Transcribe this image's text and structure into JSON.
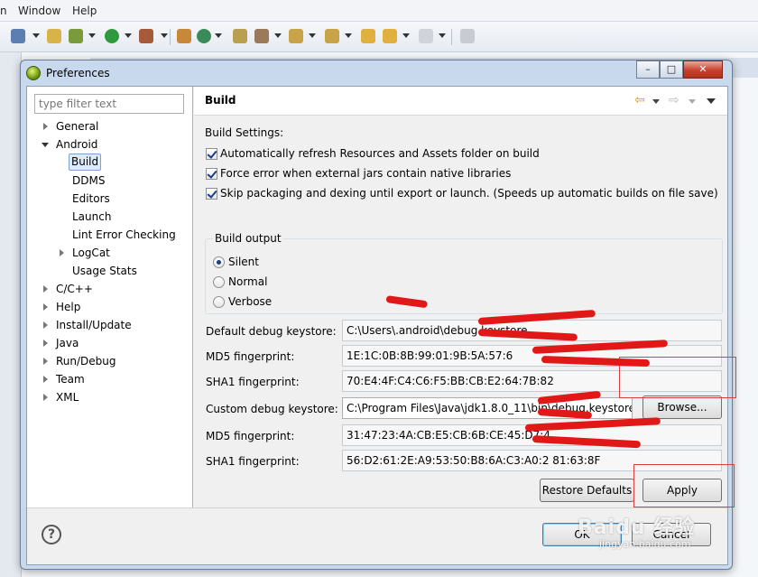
{
  "ide": {
    "menu": [
      "n",
      "Window",
      "Help"
    ]
  },
  "dialog": {
    "title": "Preferences",
    "filter_placeholder": "type filter text",
    "tree": [
      {
        "label": "General",
        "expanded": false
      },
      {
        "label": "Android",
        "expanded": true
      },
      {
        "label": "Build",
        "selected": true
      },
      {
        "label": "DDMS"
      },
      {
        "label": "Editors"
      },
      {
        "label": "Launch"
      },
      {
        "label": "Lint Error Checking"
      },
      {
        "label": "LogCat",
        "expanded": false
      },
      {
        "label": "Usage Stats"
      },
      {
        "label": "C/C++",
        "expanded": false
      },
      {
        "label": "Help",
        "expanded": false
      },
      {
        "label": "Install/Update",
        "expanded": false
      },
      {
        "label": "Java",
        "expanded": false
      },
      {
        "label": "Run/Debug",
        "expanded": false
      },
      {
        "label": "Team",
        "expanded": false
      },
      {
        "label": "XML",
        "expanded": false
      }
    ],
    "page_title": "Build",
    "build_settings_label": "Build Settings:",
    "checkboxes": [
      {
        "label": "Automatically refresh Resources and Assets folder on build",
        "checked": true
      },
      {
        "label": "Force error when external jars contain native libraries",
        "checked": true
      },
      {
        "label": "Skip packaging and dexing until export or launch. (Speeds up automatic builds on file save)",
        "checked": true
      }
    ],
    "build_output": {
      "legend": "Build output",
      "options": [
        {
          "label": "Silent",
          "selected": true
        },
        {
          "label": "Normal",
          "selected": false
        },
        {
          "label": "Verbose",
          "selected": false
        }
      ]
    },
    "fields": [
      {
        "label": "Default debug keystore:",
        "value": "C:\\Users\\.android\\debug.keystore"
      },
      {
        "label": "MD5 fingerprint:",
        "value": "1E:1C:0B:8B:99:01:9B:5A:57:6"
      },
      {
        "label": "SHA1 fingerprint:",
        "value": "70:E4:4F:C4:C6:F5:BB:CB:E2:64:7B:82"
      },
      {
        "label": "Custom debug keystore:",
        "value": "C:\\Program Files\\Java\\jdk1.8.0_11\\bin\\debug.keystore"
      },
      {
        "label": "MD5 fingerprint:",
        "value": "31:47:23:4A:CB:E5:CB:6B:CE:45:D7:4"
      },
      {
        "label": "SHA1 fingerprint:",
        "value": "56:D2:61:2E:A9:53:50:B8:6A:C3:A0:2           81:63:8F"
      }
    ],
    "browse_label": "Browse...",
    "restore_defaults_label": "Restore Defaults",
    "apply_label": "Apply",
    "ok_label": "OK",
    "cancel_label": "Cancel",
    "help_glyph": "?"
  },
  "watermark": {
    "text": "Baidu 经验",
    "sub": "jingyan.baidu.com"
  },
  "colors": {
    "redaction": "#e01818",
    "highlight": "#d84040",
    "selection": "#dcebfc"
  }
}
